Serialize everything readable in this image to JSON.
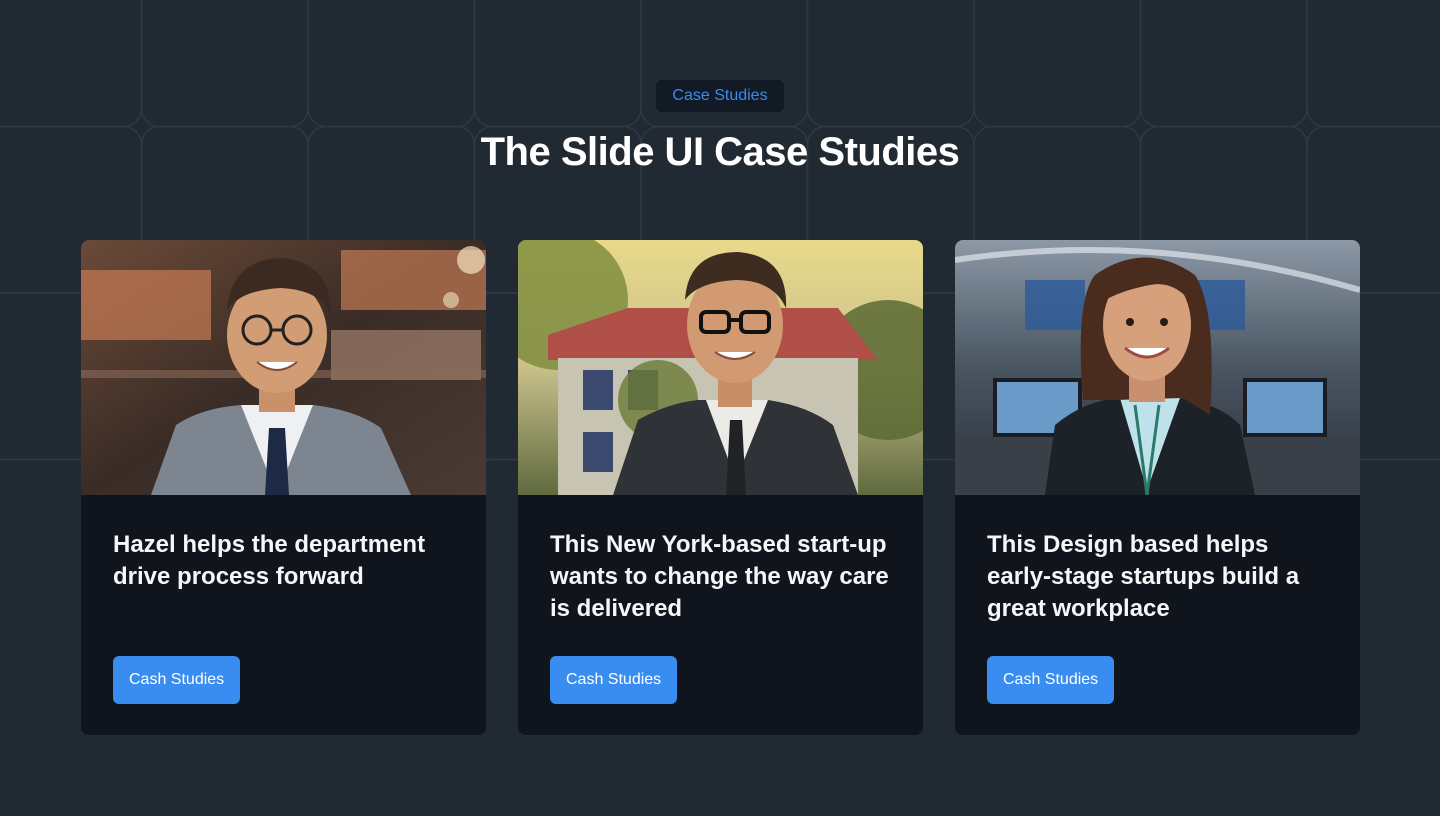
{
  "header": {
    "badge": "Case Studies",
    "title": "The Slide UI Case Studies"
  },
  "cards": [
    {
      "text": "Hazel helps the department drive process forward",
      "button": "Cash Studies",
      "image": "smiling man with glasses in grey suit, blurred shopping mall background"
    },
    {
      "text": "This New York-based start-up wants to change the way care is delivered",
      "button": "Cash Studies",
      "image": "smiling man with glasses in dark suit, house and trees in sunlight"
    },
    {
      "text": "This Design based helps early-stage startups build a great workplace",
      "button": "Cash Studies",
      "image": "smiling woman in black blazer, office with monitors background"
    }
  ],
  "colors": {
    "background": "#212a33",
    "card": "#0f141d",
    "accent": "#3a8df0"
  }
}
